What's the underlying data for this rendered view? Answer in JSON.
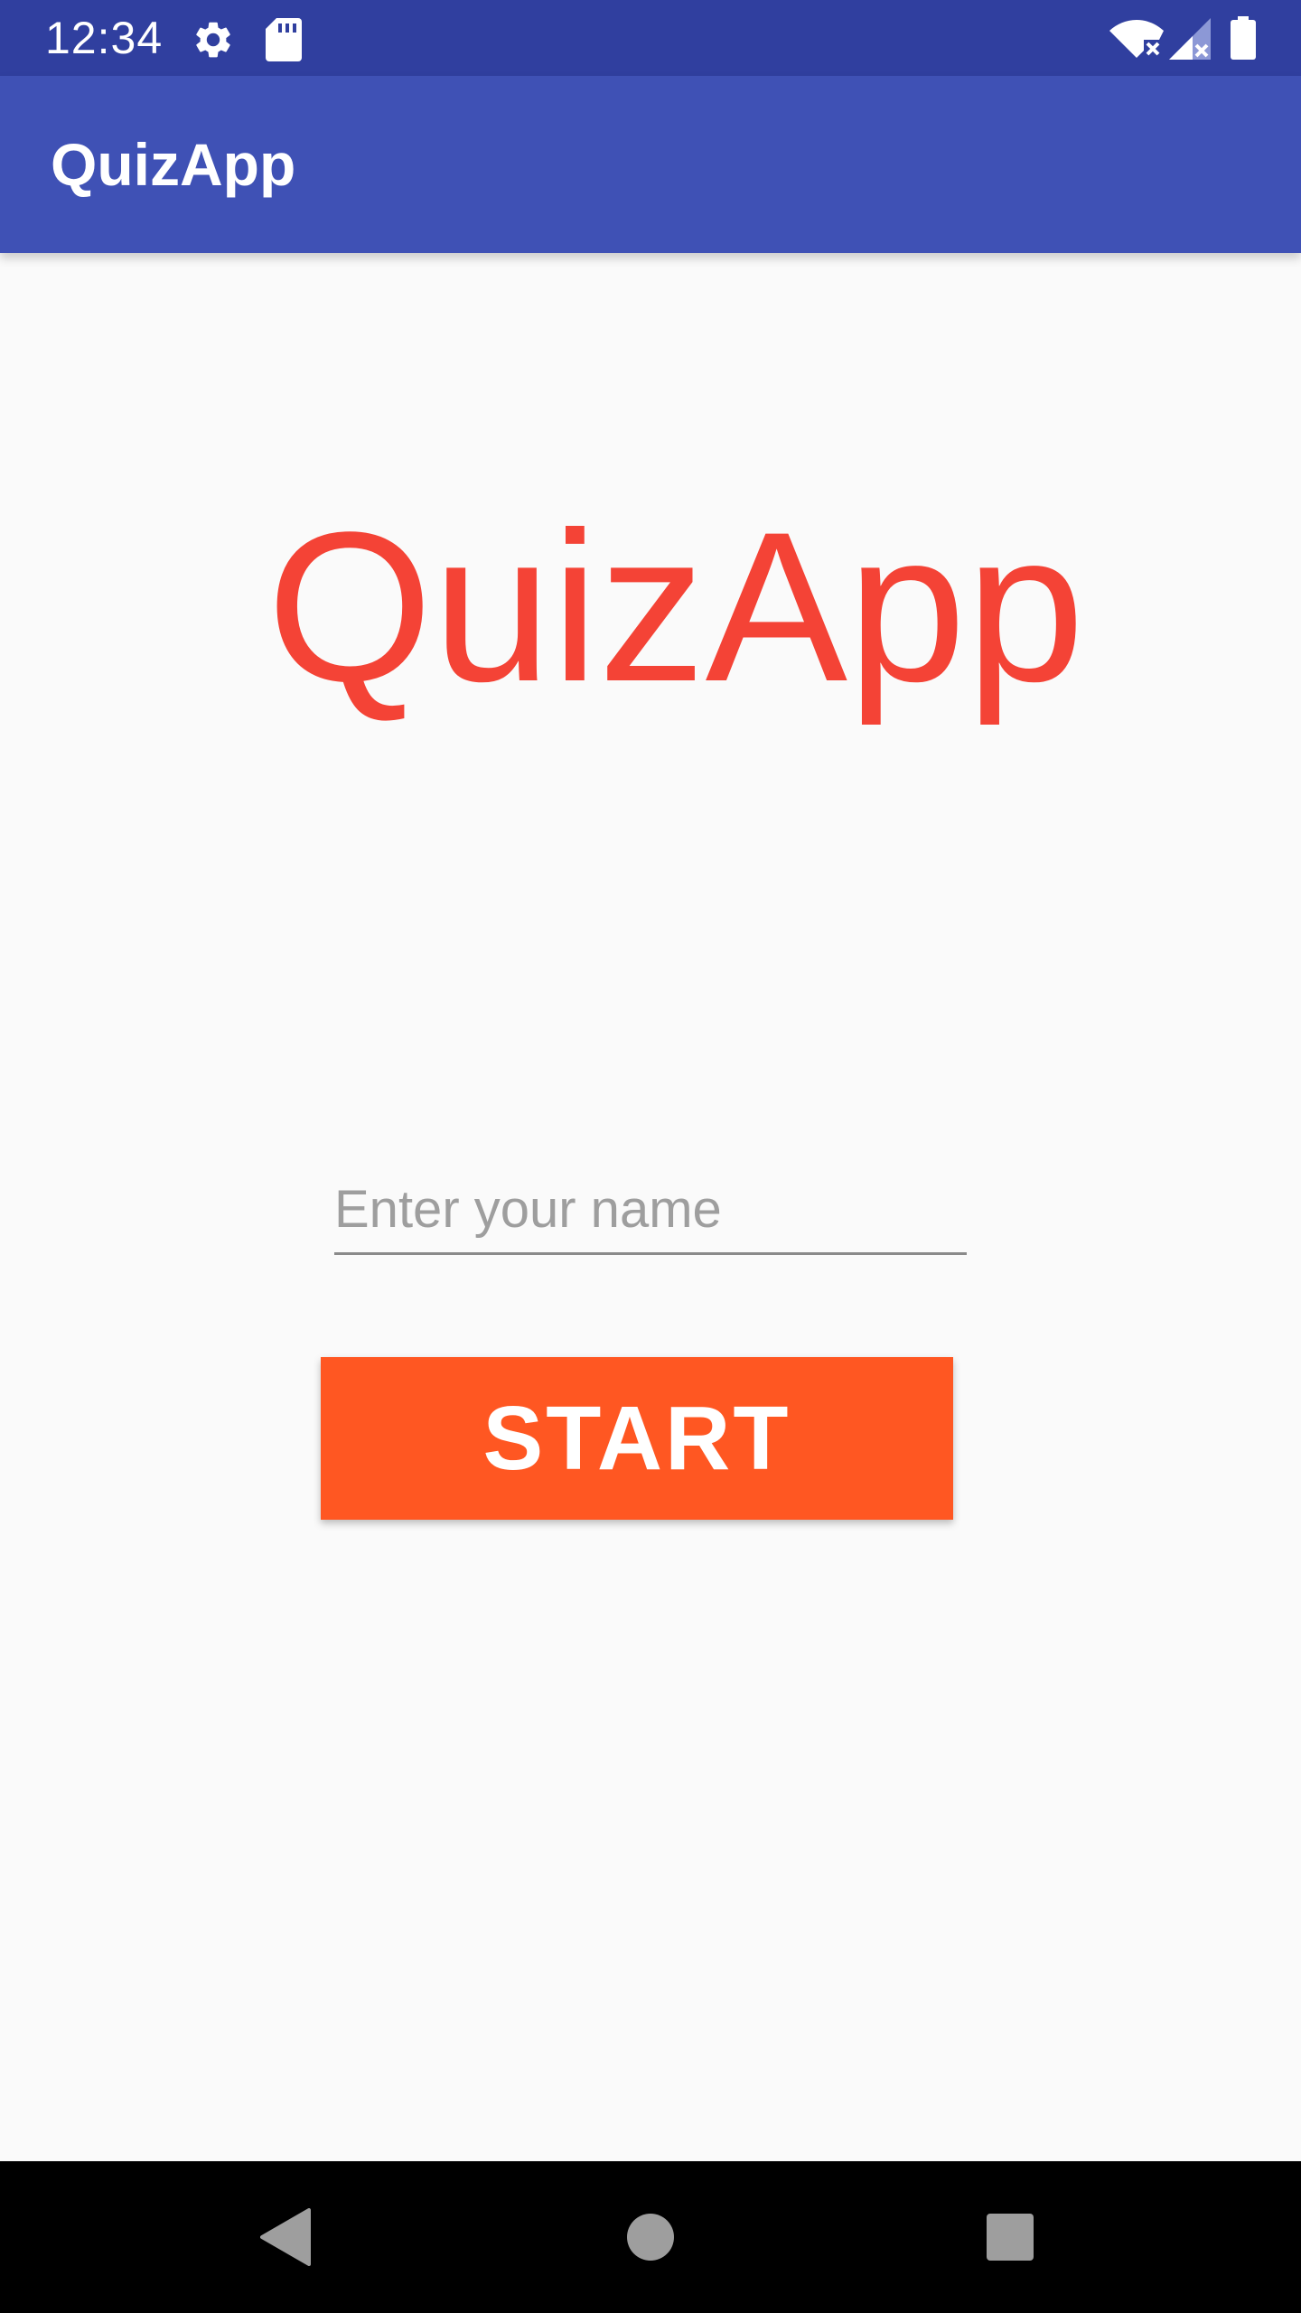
{
  "status_bar": {
    "time": "12:34",
    "icons": [
      "settings-icon",
      "sd-card-icon",
      "wifi-off-icon",
      "signal-off-icon",
      "battery-icon"
    ]
  },
  "app_bar": {
    "title": "QuizApp"
  },
  "main": {
    "hero_title": "QuizApp",
    "name_input": {
      "placeholder": "Enter your name",
      "value": ""
    },
    "start_button_label": "START"
  },
  "nav_bar": {
    "icons": [
      "back-icon",
      "home-icon",
      "recents-icon"
    ]
  },
  "colors": {
    "status_bar": "#303f9f",
    "app_bar": "#3f51b5",
    "hero_title": "#f44336",
    "start_button": "#ff5722",
    "background": "#fafafa"
  }
}
